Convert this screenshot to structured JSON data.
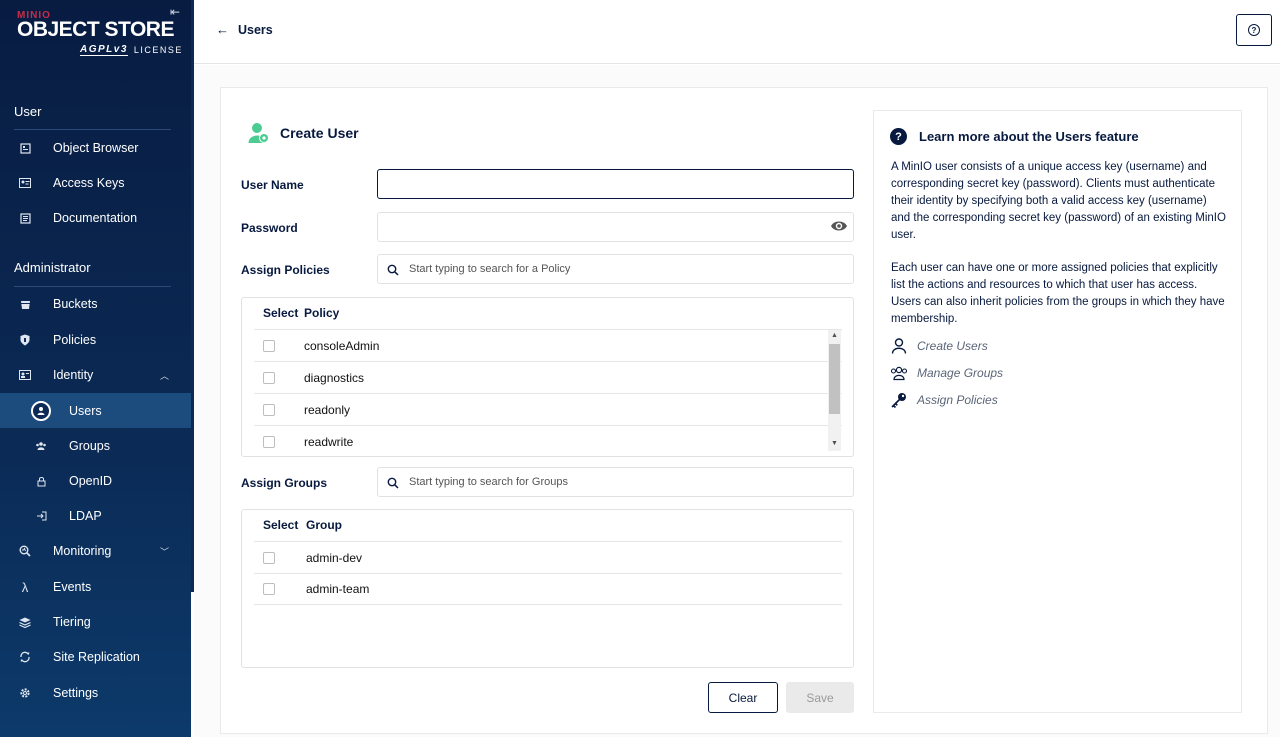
{
  "brand": {
    "minio": "MINIO",
    "product": "OBJECT STORE",
    "agpl": "AGPLv3",
    "license": "LICENSE"
  },
  "sidebar": {
    "user_section": "User",
    "user_items": [
      {
        "label": "Object Browser",
        "icon": "object-browser-icon"
      },
      {
        "label": "Access Keys",
        "icon": "access-keys-icon"
      },
      {
        "label": "Documentation",
        "icon": "documentation-icon"
      }
    ],
    "admin_section": "Administrator",
    "admin_items": [
      {
        "label": "Buckets",
        "icon": "buckets-icon"
      },
      {
        "label": "Policies",
        "icon": "policies-icon"
      },
      {
        "label": "Identity",
        "icon": "identity-icon"
      }
    ],
    "identity_sub": [
      {
        "label": "Users",
        "icon": "users-icon",
        "active": true
      },
      {
        "label": "Groups",
        "icon": "groups-icon"
      },
      {
        "label": "OpenID",
        "icon": "openid-icon"
      },
      {
        "label": "LDAP",
        "icon": "ldap-icon"
      }
    ],
    "more_items": [
      {
        "label": "Monitoring",
        "icon": "monitoring-icon"
      },
      {
        "label": "Events",
        "icon": "lambda-icon"
      },
      {
        "label": "Tiering",
        "icon": "tiering-icon"
      },
      {
        "label": "Site Replication",
        "icon": "site-replication-icon"
      },
      {
        "label": "Settings",
        "icon": "settings-icon"
      }
    ]
  },
  "header": {
    "back_label": "Users"
  },
  "form": {
    "title": "Create User",
    "username_label": "User Name",
    "username_value": "",
    "password_label": "Password",
    "password_value": "",
    "policies_label": "Assign Policies",
    "policies_placeholder": "Start typing to search for a Policy",
    "policy_table": {
      "headers": [
        "Select",
        "Policy"
      ],
      "rows": [
        "consoleAdmin",
        "diagnostics",
        "readonly",
        "readwrite"
      ]
    },
    "groups_label": "Assign Groups",
    "groups_placeholder": "Start typing to search for Groups",
    "group_table": {
      "headers": [
        "Select",
        "Group"
      ],
      "rows": [
        "admin-dev",
        "admin-team"
      ]
    },
    "clear_label": "Clear",
    "save_label": "Save"
  },
  "help": {
    "title": "Learn more about the Users feature",
    "para1": "A MinIO user consists of a unique access key (username) and corresponding secret key (password). Clients must authenticate their identity by specifying both a valid access key (username) and the corresponding secret key (password) of an existing MinIO user.",
    "para2": "Each user can have one or more assigned policies that explicitly list the actions and resources to which that user has access. Users can also inherit policies from the groups in which they have membership.",
    "links": [
      "Create Users",
      "Manage Groups",
      "Assign Policies"
    ]
  },
  "colors": {
    "sidebar_bg": "#081c42",
    "active_item": "#1c4c7e",
    "brand_red": "#c72c48",
    "accent_green": "#4ccb92"
  }
}
